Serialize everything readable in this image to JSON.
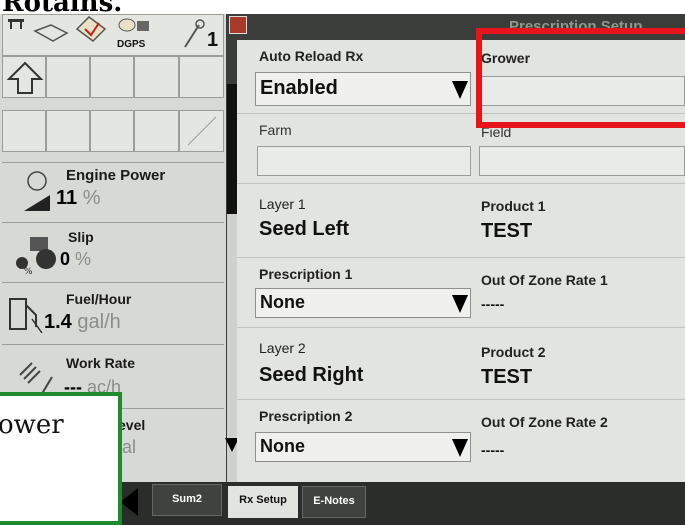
{
  "caption": {
    "text": "Rotains."
  },
  "header": {
    "title": "Prescription Setup",
    "icon_labels": {
      "dgps": "DGPS",
      "number": "1"
    }
  },
  "left_panel": {
    "engine_power": {
      "label": "Engine Power",
      "value": "11",
      "unit": "%"
    },
    "slip": {
      "label": "Slip",
      "value": "0",
      "unit": "%"
    },
    "fuel_hour": {
      "label": "Fuel/Hour",
      "value": "1.4",
      "unit": "gal/h"
    },
    "work_rate": {
      "label": "Work Rate",
      "value": "---",
      "unit": "ac/h"
    },
    "fuel_level": {
      "label": "evel",
      "value": "",
      "unit": "al"
    }
  },
  "overlay": {
    "text": "ower"
  },
  "form": {
    "auto_reload": {
      "label": "Auto Reload Rx",
      "value": "Enabled"
    },
    "grower": {
      "label": "Grower",
      "value": ""
    },
    "farm": {
      "label": "Farm",
      "value": ""
    },
    "field": {
      "label": "Field",
      "value": ""
    },
    "layer1": {
      "label": "Layer 1",
      "value": "Seed Left"
    },
    "product1": {
      "label": "Product 1",
      "value": "TEST"
    },
    "prescription1": {
      "label": "Prescription 1",
      "value": "None"
    },
    "out_of_zone1": {
      "label": "Out Of Zone Rate 1",
      "value": "-----"
    },
    "layer2": {
      "label": "Layer 2",
      "value": "Seed Right"
    },
    "product2": {
      "label": "Product 2",
      "value": "TEST"
    },
    "prescription2": {
      "label": "Prescription 2",
      "value": "None"
    },
    "out_of_zone2": {
      "label": "Out Of Zone Rate 2",
      "value": "-----"
    }
  },
  "tabs": [
    {
      "label": "Sum2"
    },
    {
      "label": "Rx Setup"
    },
    {
      "label": "E-Notes"
    }
  ],
  "colors": {
    "highlight": "#e8141b",
    "overlay_border": "#1f8a2e",
    "screen_bg": "#e2e4df"
  }
}
